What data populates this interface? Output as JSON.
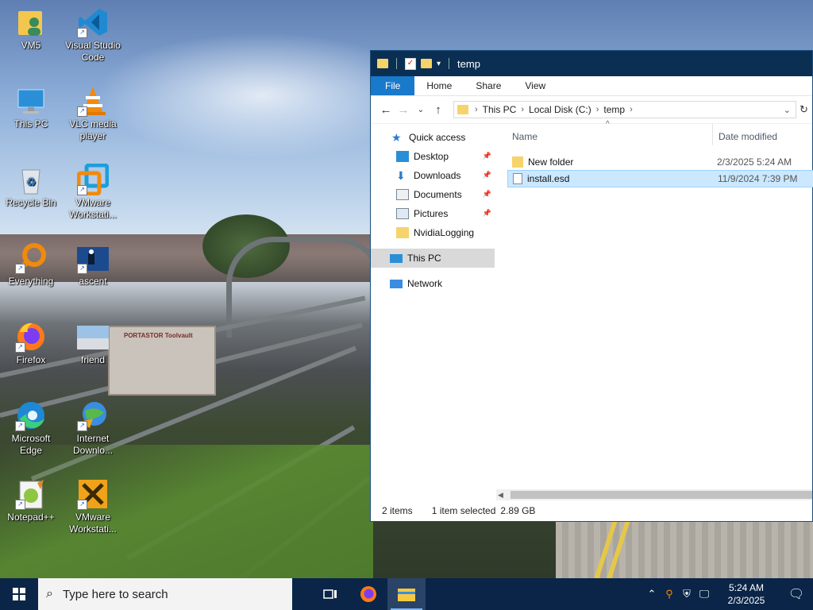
{
  "desktop": {
    "icons": [
      {
        "label": "VM5"
      },
      {
        "label": "Visual Studio Code"
      },
      {
        "label": "This PC"
      },
      {
        "label": "VLC media player"
      },
      {
        "label": "Recycle Bin"
      },
      {
        "label": "VMware Workstati..."
      },
      {
        "label": "Everything"
      },
      {
        "label": "ascent"
      },
      {
        "label": "Firefox"
      },
      {
        "label": "friend"
      },
      {
        "label": "Microsoft Edge"
      },
      {
        "label": "Internet Downlo..."
      },
      {
        "label": "Notepad++"
      },
      {
        "label": "VMware Workstati..."
      }
    ],
    "wallpaper_text": "PORTASTOR Toolvault"
  },
  "explorer": {
    "title": "temp",
    "ribbon_tabs": [
      "File",
      "Home",
      "Share",
      "View"
    ],
    "address": {
      "segments": [
        "This PC",
        "Local Disk (C:)",
        "temp"
      ]
    },
    "nav": {
      "quick_access": "Quick access",
      "items": [
        "Desktop",
        "Downloads",
        "Documents",
        "Pictures",
        "NvidiaLogging"
      ],
      "this_pc": "This PC",
      "network": "Network"
    },
    "columns": {
      "name": "Name",
      "date": "Date modified"
    },
    "files": [
      {
        "name": "New folder",
        "date": "2/3/2025 5:24 AM",
        "type": "folder"
      },
      {
        "name": "install.esd",
        "date": "11/9/2024 7:39 PM",
        "type": "file",
        "selected": true
      }
    ],
    "status": {
      "count": "2 items",
      "selection": "1 item selected",
      "size": "2.89 GB"
    }
  },
  "taskbar": {
    "search_placeholder": "Type here to search",
    "time": "5:24 AM",
    "date": "2/3/2025"
  },
  "colors": {
    "taskbar": "#0a2547",
    "titlebar": "#0b2f52",
    "file_tab": "#1979ca",
    "selection": "#cce8ff"
  }
}
